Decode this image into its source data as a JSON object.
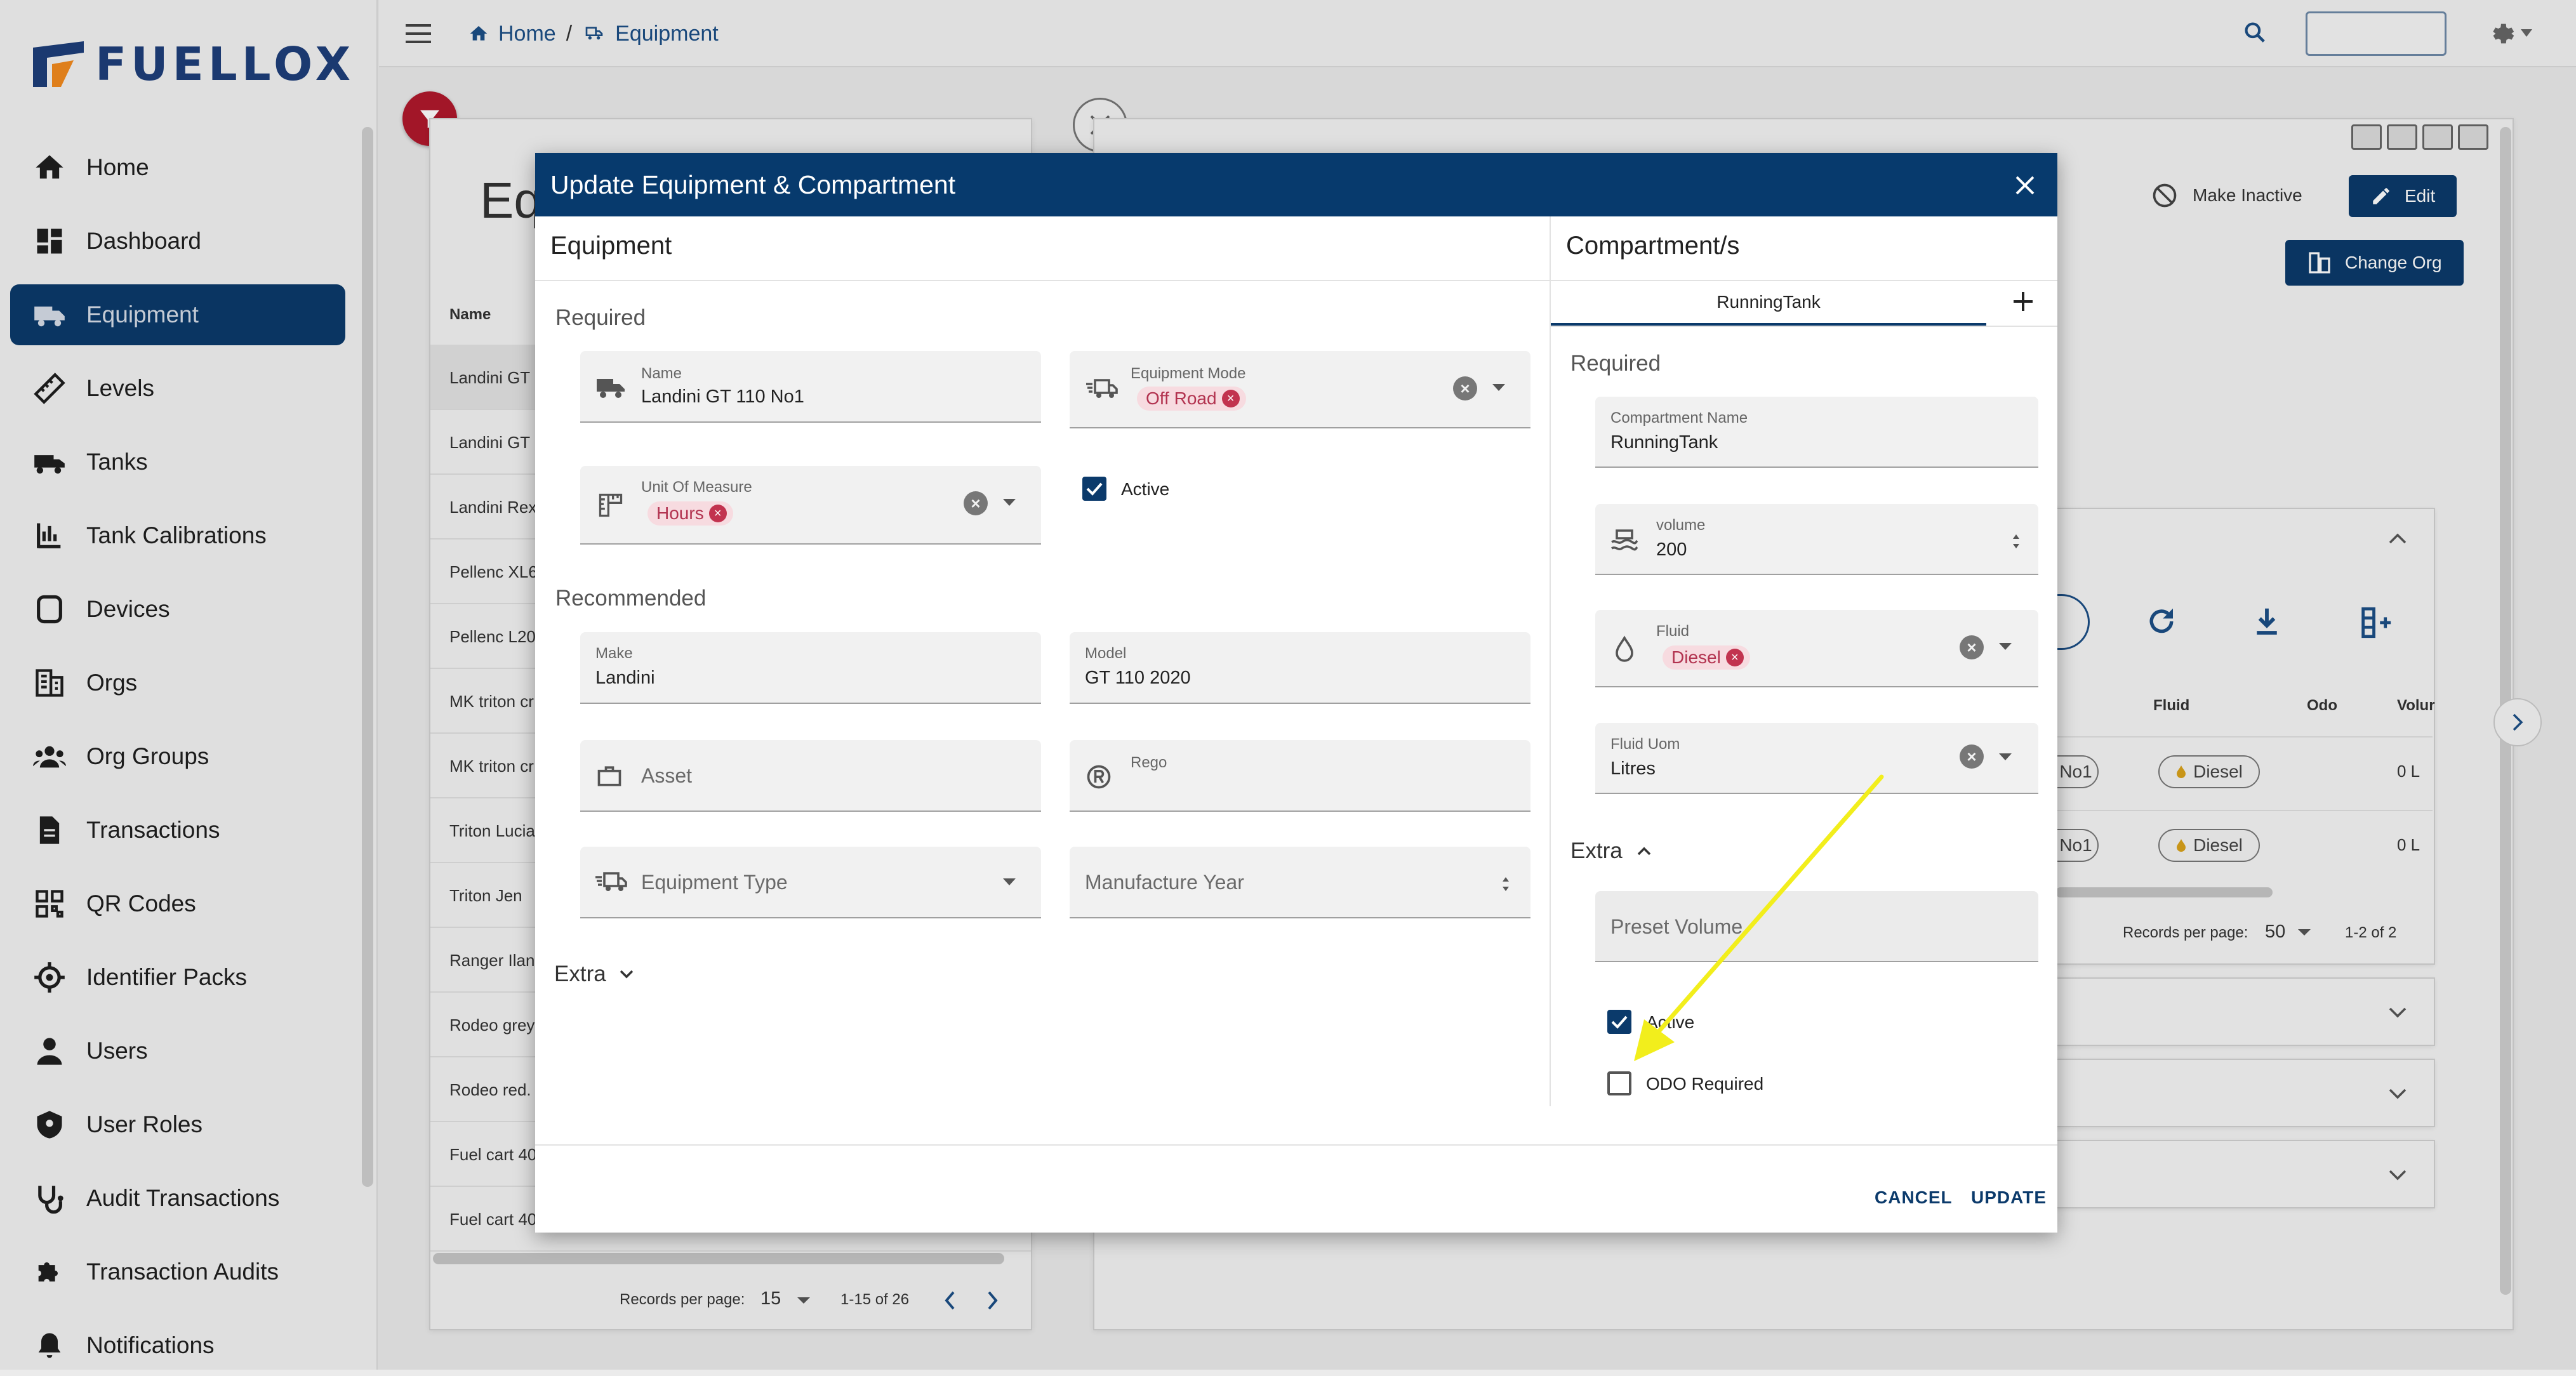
{
  "app": {
    "brand": "FUELLOX"
  },
  "sidebar": {
    "items": [
      {
        "label": "Home",
        "icon": "home-icon"
      },
      {
        "label": "Dashboard",
        "icon": "dashboard-icon"
      },
      {
        "label": "Equipment",
        "icon": "truck-icon",
        "active": true
      },
      {
        "label": "Levels",
        "icon": "ruler-icon"
      },
      {
        "label": "Tanks",
        "icon": "tank-truck-icon"
      },
      {
        "label": "Tank Calibrations",
        "icon": "calibration-icon"
      },
      {
        "label": "Devices",
        "icon": "device-icon"
      },
      {
        "label": "Orgs",
        "icon": "building-icon"
      },
      {
        "label": "Org Groups",
        "icon": "group-icon"
      },
      {
        "label": "Transactions",
        "icon": "document-icon"
      },
      {
        "label": "QR Codes",
        "icon": "qr-code-icon"
      },
      {
        "label": "Identifier Packs",
        "icon": "crosshair-icon"
      },
      {
        "label": "Users",
        "icon": "user-icon"
      },
      {
        "label": "User Roles",
        "icon": "shield-icon"
      },
      {
        "label": "Audit Transactions",
        "icon": "stethoscope-icon"
      },
      {
        "label": "Transaction Audits",
        "icon": "puzzle-icon"
      },
      {
        "label": "Notifications",
        "icon": "bell-icon"
      }
    ]
  },
  "topbar": {
    "breadcrumb": {
      "home": "Home",
      "separator": "/",
      "current": "Equipment"
    }
  },
  "background": {
    "list_title": "Eq",
    "column_name": "Name",
    "rows": [
      "Landini GT",
      "Landini GT",
      "Landini Rex",
      "Pellenc XL6",
      "Pellenc L20",
      "MK triton cr",
      "MK triton cr",
      "Triton Lucia",
      "Triton Jen",
      "Ranger Ilan",
      "Rodeo grey",
      "Rodeo red. I",
      "Fuel cart 40",
      "Fuel cart 40"
    ],
    "pagination": {
      "label": "Records per page:",
      "per_page": "15",
      "range": "1-15 of 26"
    },
    "detail": {
      "make_inactive": "Make Inactive",
      "edit": "Edit",
      "change_org": "Change Org",
      "columns": [
        "Fluid",
        "Odo",
        "Volur"
      ],
      "rows": [
        {
          "name": "No1",
          "fluid": "Diesel",
          "odo": "",
          "volume": "0 L"
        },
        {
          "name": "No1",
          "fluid": "Diesel",
          "odo": "",
          "volume": "0 L"
        }
      ],
      "pagination": {
        "label": "Records per page:",
        "per_page": "50",
        "range": "1-2 of 2"
      }
    }
  },
  "modal": {
    "title": "Update Equipment & Compartment",
    "equipment": {
      "heading": "Equipment",
      "required_label": "Required",
      "name": {
        "label": "Name",
        "value": "Landini GT 110 No1"
      },
      "equipment_mode": {
        "label": "Equipment Mode",
        "value": "Off Road"
      },
      "unit_of_measure": {
        "label": "Unit Of Measure",
        "value": "Hours"
      },
      "active": {
        "label": "Active",
        "checked": true
      },
      "recommended_label": "Recommended",
      "make": {
        "label": "Make",
        "value": "Landini"
      },
      "model": {
        "label": "Model",
        "value": "GT 110 2020"
      },
      "asset": {
        "placeholder": "Asset"
      },
      "rego": {
        "label": "Rego",
        "value": ""
      },
      "equipment_type": {
        "placeholder": "Equipment Type"
      },
      "manufacture_year": {
        "placeholder": "Manufacture Year"
      },
      "extra_label": "Extra"
    },
    "compartments": {
      "heading": "Compartment/s",
      "tabs": [
        {
          "label": "RunningTank",
          "active": true
        }
      ],
      "required_label": "Required",
      "compartment_name": {
        "label": "Compartment Name",
        "value": "RunningTank"
      },
      "volume": {
        "label": "volume",
        "value": "200"
      },
      "fluid": {
        "label": "Fluid",
        "value": "Diesel"
      },
      "fluid_uom": {
        "label": "Fluid Uom",
        "value": "Litres"
      },
      "extra_label": "Extra",
      "preset_volume": {
        "placeholder": "Preset Volume"
      },
      "active": {
        "label": "Active",
        "checked": true
      },
      "odo_required": {
        "label": "ODO Required",
        "checked": false
      }
    },
    "actions": {
      "cancel": "CANCEL",
      "update": "UPDATE"
    }
  },
  "colors": {
    "primary": "#0b3a6b",
    "header": "#073a6d",
    "chip_bg": "#f7dbe0",
    "chip_text": "#b2324f",
    "annotation_arrow": "#f2ee1c"
  }
}
